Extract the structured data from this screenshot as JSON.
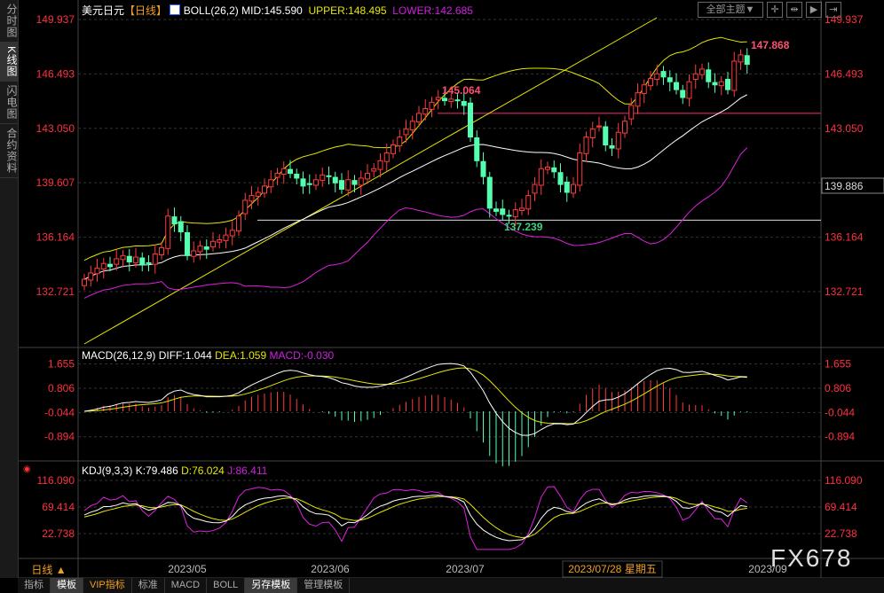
{
  "sidebar": {
    "tabs": [
      "分时图",
      "K线图",
      "闪电图",
      "合约资料"
    ],
    "active": 1
  },
  "header": {
    "symbol": "美元日元",
    "period": "【日线】",
    "boll": "BOLL(26,2)",
    "mid": "MID:145.590",
    "upper": "UPPER:148.495",
    "lower": "LOWER:142.685",
    "theme_select": "全部主题▼"
  },
  "macd_header": {
    "name": "MACD(26,12,9)",
    "diff": "DIFF:1.044",
    "dea": "DEA:1.059",
    "macd": "MACD:-0.030"
  },
  "kdj_header": {
    "name": "KDJ(9,3,3)",
    "k": "K:79.486",
    "d": "D:76.024",
    "j": "J:86.411"
  },
  "price_axis": [
    "149.937",
    "146.493",
    "143.050",
    "139.607",
    "136.164",
    "132.721"
  ],
  "macd_axis": [
    "1.655",
    "0.806",
    "-0.044",
    "-0.894"
  ],
  "kdj_axis": [
    "116.090",
    "69.414",
    "22.738"
  ],
  "current_price": "139.886",
  "annotations": {
    "high_mid": "145.064",
    "low": "137.239",
    "high": "147.868"
  },
  "time_axis": {
    "period": "日线 ▲",
    "labels": [
      "2023/05",
      "2023/06",
      "2023/07",
      "2023/09"
    ],
    "cursor": "2023/07/28 星期五"
  },
  "watermark": "FX678",
  "bottom_tabs": [
    "指标",
    "模板",
    "VIP指标",
    "标准",
    "MACD",
    "BOLL",
    "另存模板",
    "管理模板"
  ],
  "colors": {
    "up": "#ff3b3b",
    "down": "#54ffb0",
    "upper": "#e6e600",
    "lower": "#e020e0",
    "mid": "#ffffff",
    "axis": "#ff3040"
  },
  "chart_data": {
    "type": "candlestick",
    "price_range": [
      132.721,
      149.937
    ],
    "closes": [
      133.5,
      133.9,
      134.2,
      134.5,
      134.3,
      134.8,
      135.0,
      134.6,
      134.9,
      134.4,
      134.5,
      135.1,
      135.5,
      137.5,
      137.0,
      136.5,
      135.0,
      135.3,
      135.6,
      135.4,
      135.9,
      136.0,
      136.3,
      136.6,
      137.5,
      138.5,
      138.8,
      139.0,
      139.4,
      139.8,
      140.2,
      140.5,
      140.2,
      139.9,
      139.4,
      139.5,
      139.8,
      140.1,
      140.0,
      139.6,
      139.2,
      139.8,
      139.5,
      139.9,
      140.2,
      140.5,
      141.0,
      141.5,
      142.0,
      142.5,
      143.0,
      143.5,
      144.0,
      144.3,
      144.7,
      145.0,
      144.8,
      144.9,
      144.8,
      144.5,
      142.5,
      141.0,
      140.0,
      138.0,
      137.8,
      137.6,
      137.5,
      137.9,
      138.0,
      138.8,
      139.5,
      140.5,
      140.6,
      140.3,
      139.5,
      139.0,
      139.5,
      141.5,
      142.5,
      143.0,
      143.2,
      142.0,
      141.8,
      142.8,
      143.5,
      144.5,
      145.3,
      145.8,
      146.2,
      146.5,
      146.3,
      146.0,
      145.5,
      145.0,
      146.0,
      146.5,
      146.8,
      146.0,
      145.8,
      146.0,
      145.5,
      147.3,
      147.7,
      147.1
    ],
    "hlines": [
      144.0,
      137.239
    ]
  }
}
